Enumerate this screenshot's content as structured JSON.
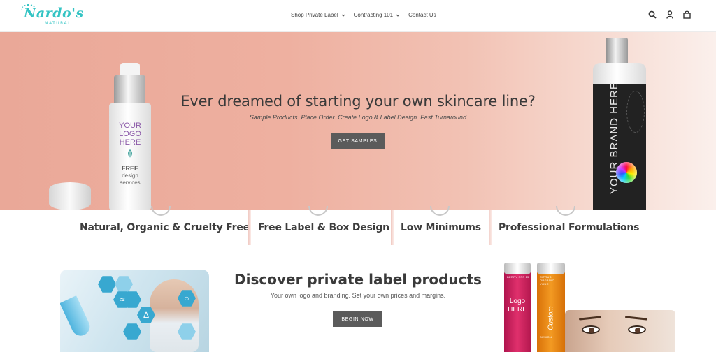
{
  "header": {
    "logo_text": "Nardo's",
    "logo_sub": "NATURAL",
    "nav": [
      {
        "label": "Shop Private Label",
        "has_dropdown": true
      },
      {
        "label": "Contracting 101",
        "has_dropdown": true
      },
      {
        "label": "Contact Us",
        "has_dropdown": false
      }
    ],
    "icons": [
      "search-icon",
      "account-icon",
      "cart-icon"
    ]
  },
  "hero": {
    "title": "Ever dreamed of starting your own skincare line?",
    "subtitle": "Sample Products. Place Order. Create Logo & Label Design. Fast Turnaround",
    "button": "GET SAMPLES",
    "left_bottle": {
      "line1": "YOUR",
      "line2": "LOGO",
      "line3": "HERE",
      "free": "FREE",
      "design": "design",
      "services": "services"
    },
    "right_bottle": {
      "text": "YOUR BRAND HERE"
    }
  },
  "features": [
    {
      "label": "Natural, Organic & Cruelty Free"
    },
    {
      "label": "Free Label & Box Design"
    },
    {
      "label": "Low Minimums"
    },
    {
      "label": "Professional Formulations"
    }
  ],
  "discover": {
    "title": "Discover private label products",
    "subtitle": "Your own logo and branding. Set your own prices and margins.",
    "button": "BEGIN NOW"
  },
  "balms": {
    "pink_small": "BERRY SPF 15",
    "pink_text1": "Logo",
    "pink_text2": "HERE",
    "orange_small": "CITRUS ORGANIC",
    "orange_text": "Custom",
    "orange_your": "YOUR",
    "orange_design": "DESIGN"
  },
  "colors": {
    "brand_teal": "#34c4c4",
    "hero_salmon": "#eaa898",
    "button_gray": "#5b5b5b",
    "accent_purple": "#8b5aa8"
  }
}
